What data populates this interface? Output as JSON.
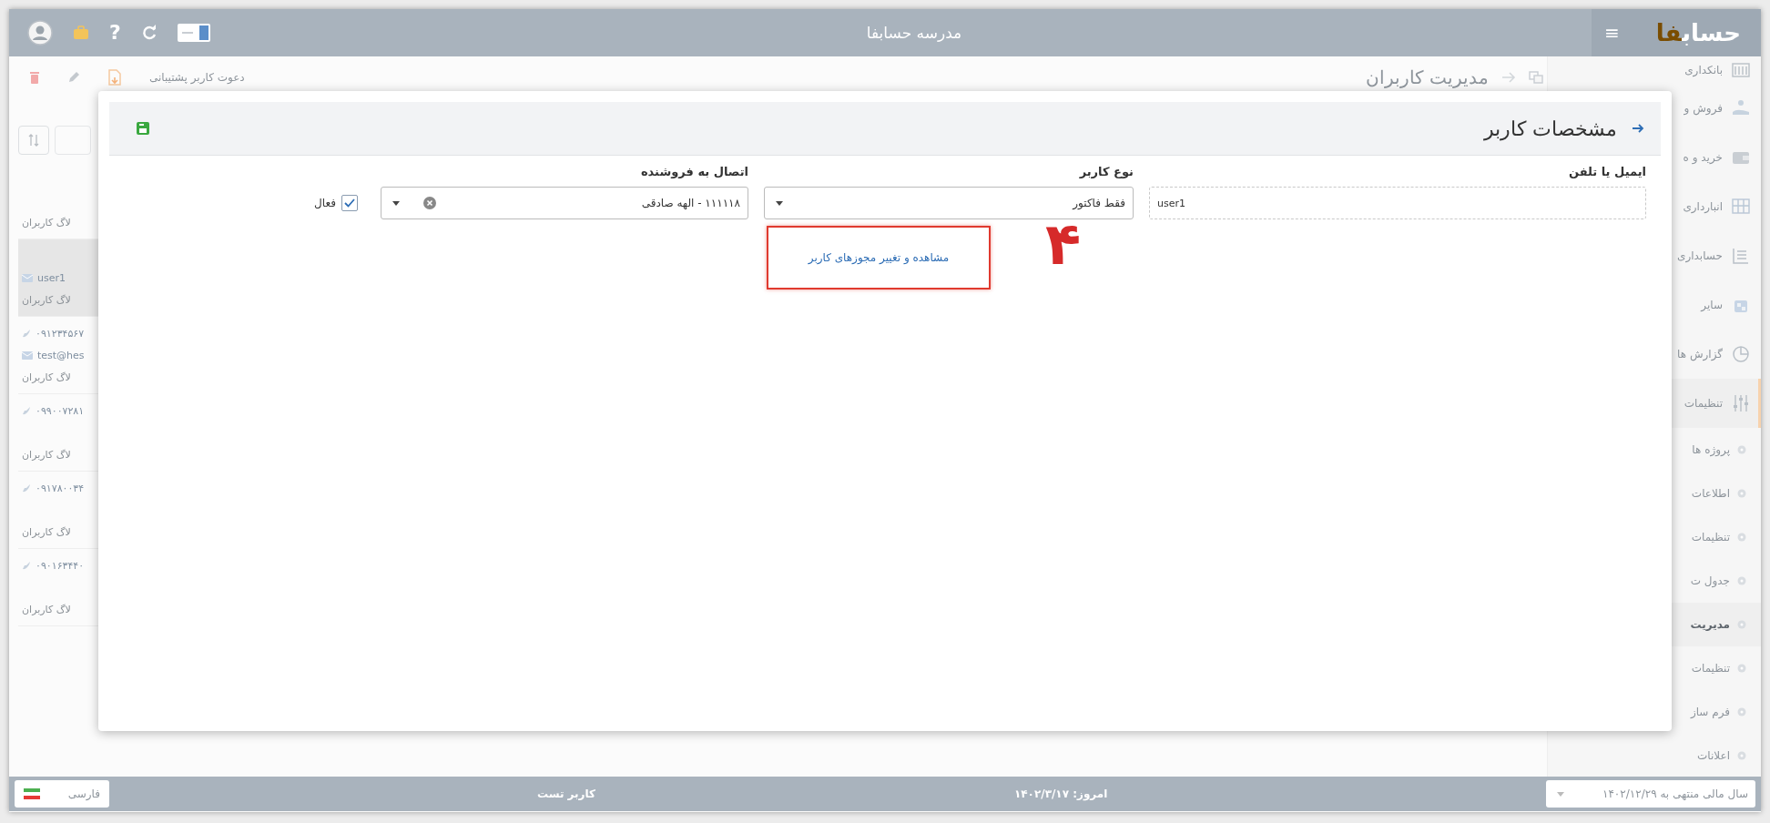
{
  "topbar": {
    "title": "مدرسه حسابفا",
    "logo": {
      "main": "حساب",
      "accent": "فا"
    },
    "menu_button": "≡",
    "help_button": "?"
  },
  "page": {
    "title": "مدیریت کاربران",
    "invite_button": "دعوت کاربر پشتیبانی"
  },
  "user_list": [
    {
      "log_link": "لاگ کاربران",
      "selected": false
    },
    {
      "email": "user1",
      "log_link": "لاگ کاربران",
      "selected": true
    },
    {
      "phone": "۰۹۱۲۳۴۵۶۷",
      "email": "test@hes",
      "log_link": "لاگ کاربران",
      "selected": false
    },
    {
      "phone": "۰۹۹۰۰۷۲۸۱",
      "log_link": "لاگ کاربران",
      "selected": false
    },
    {
      "phone": "۰۹۱۷۸۰۰۳۴",
      "log_link": "لاگ کاربران",
      "selected": false
    },
    {
      "phone": "۰۹۰۱۶۳۴۴۰",
      "log_link": "لاگ کاربران",
      "selected": false
    }
  ],
  "sidebar": {
    "items": [
      {
        "label": "بانکداری",
        "kind": "bank",
        "expanded": false
      },
      {
        "label": "فروش و",
        "kind": "sales",
        "expanded": false
      },
      {
        "label": "خرید و ه",
        "kind": "purchase",
        "expanded": false
      },
      {
        "label": "انبارداری",
        "kind": "warehouse",
        "expanded": false
      },
      {
        "label": "حسابداری",
        "kind": "accounting",
        "expanded": false
      },
      {
        "label": "سایر",
        "kind": "other",
        "expanded": false
      },
      {
        "label": "گزارش ها",
        "kind": "reports",
        "expanded": false
      },
      {
        "label": "تنظیمات",
        "kind": "settings",
        "expanded": true,
        "children": [
          {
            "label": "پروژه ها",
            "selected": false
          },
          {
            "label": "اطلاعات",
            "selected": false
          },
          {
            "label": "تنظیمات",
            "selected": false
          },
          {
            "label": "جدول ت",
            "selected": false
          },
          {
            "label": "مدیریت",
            "selected": true
          },
          {
            "label": "تنظیمات",
            "selected": false
          },
          {
            "label": "فرم ساز",
            "selected": false
          },
          {
            "label": "اعلانات",
            "selected": false
          }
        ]
      }
    ]
  },
  "dialog": {
    "title": "مشخصات کاربر",
    "fields": [
      {
        "kind": "text",
        "label": "ایمیل یا تلفن",
        "value": "user1"
      },
      {
        "kind": "select",
        "label": "نوع کاربر",
        "value": "فقط فاکتور",
        "clearable": false
      },
      {
        "kind": "select",
        "label": "اتصال به فروشنده",
        "value": "۱۱۱۱۱۸ - الهه صادقی",
        "clearable": true
      }
    ],
    "active": {
      "label": "فعال",
      "checked": true
    },
    "permissions_link": "مشاهده و تغییر مجوزهای کاربر",
    "annotation": "۴"
  },
  "status_bar": {
    "language": "فارسی",
    "user": "کاربر تست",
    "today": "امروز: ۱۴۰۲/۳/۱۷",
    "fiscal_year": "سال مالی منتهی به ۱۴۰۲/۱۲/۲۹"
  }
}
